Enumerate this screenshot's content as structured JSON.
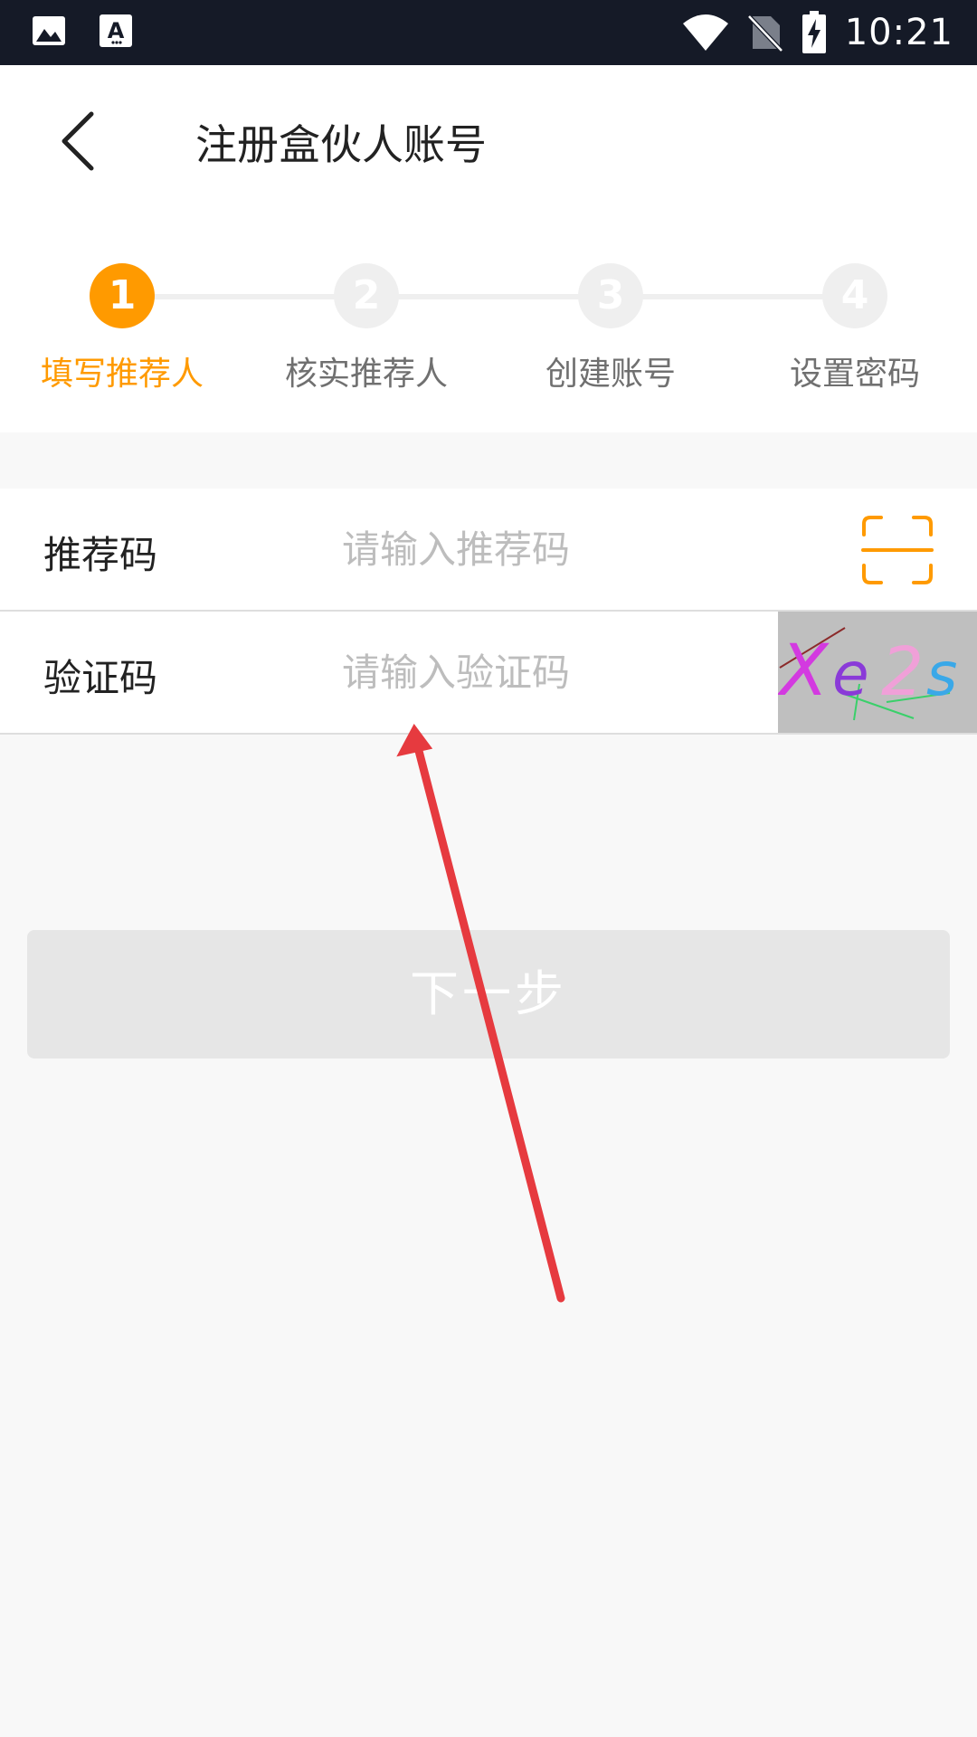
{
  "status_bar": {
    "time": "10:21",
    "icons": [
      "image-icon",
      "text-a-icon",
      "wifi-icon",
      "no-sim-icon",
      "battery-charging-icon"
    ]
  },
  "header": {
    "title": "注册盒伙人账号",
    "back_icon": "chevron-left-icon"
  },
  "stepper": {
    "active_index": 0,
    "steps": [
      {
        "number": "1",
        "label": "填写推荐人"
      },
      {
        "number": "2",
        "label": "核实推荐人"
      },
      {
        "number": "3",
        "label": "创建账号"
      },
      {
        "number": "4",
        "label": "设置密码"
      }
    ]
  },
  "form": {
    "referral": {
      "label": "推荐码",
      "placeholder": "请输入推荐码",
      "value": "",
      "scan_icon": "scan-icon"
    },
    "captcha": {
      "label": "验证码",
      "placeholder": "请输入验证码",
      "value": "",
      "image_text": "Xe2s"
    }
  },
  "next_button": {
    "label": "下一步"
  },
  "colors": {
    "accent": "#ff9a00",
    "status_bar": "#151a27",
    "inactive": "#efefef",
    "disabled_button": "#e6e6e6",
    "annotation": "#e63a3f"
  }
}
